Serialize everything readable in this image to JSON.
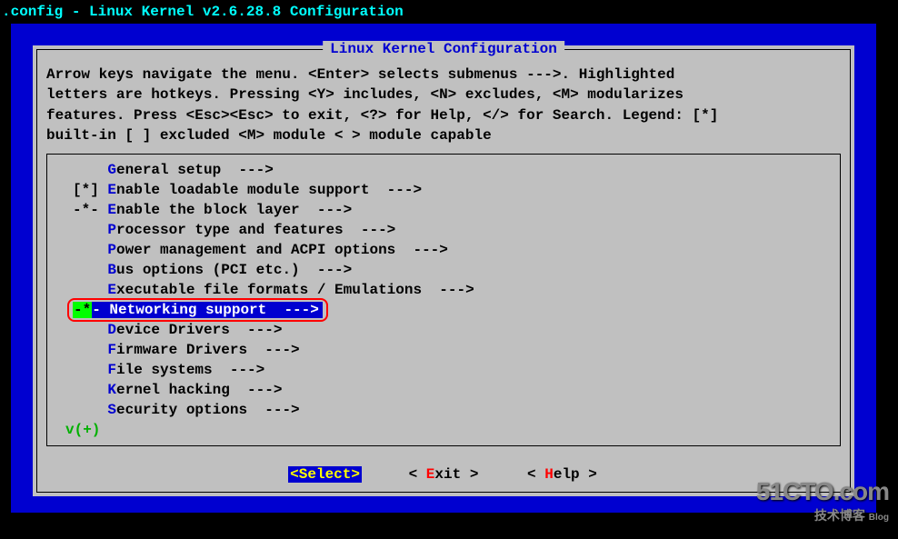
{
  "title_bar": ".config - Linux Kernel v2.6.28.8 Configuration",
  "box_title": "Linux Kernel Configuration",
  "help_lines": [
    "Arrow keys navigate the menu.  <Enter> selects submenus --->.  Highlighted",
    "letters are hotkeys.  Pressing <Y> includes, <N> excludes, <M> modularizes",
    "features.  Press <Esc><Esc> to exit, <?> for Help, </> for Search.  Legend: [*]",
    "built-in  [ ] excluded  <M> module  < > module capable"
  ],
  "menu": [
    {
      "prefix": "    ",
      "hot": "G",
      "rest": "eneral setup  --->",
      "selected": false
    },
    {
      "prefix": "[*] ",
      "hot": "E",
      "rest": "nable loadable module support  --->",
      "selected": false
    },
    {
      "prefix": "-*- ",
      "hot": "E",
      "rest": "nable the block layer  --->",
      "selected": false
    },
    {
      "prefix": "    ",
      "hot": "P",
      "rest": "rocessor type and features  --->",
      "selected": false
    },
    {
      "prefix": "    ",
      "hot": "P",
      "rest": "ower management and ACPI options  --->",
      "selected": false
    },
    {
      "prefix": "    ",
      "hot": "B",
      "rest": "us options (PCI etc.)  --->",
      "selected": false
    },
    {
      "prefix": "    ",
      "hot": "E",
      "rest": "xecutable file formats / Emulations  --->",
      "selected": false
    },
    {
      "prefix": "-*- ",
      "hot": "N",
      "rest": "etworking support  --->",
      "selected": true
    },
    {
      "prefix": "    ",
      "hot": "D",
      "rest": "evice Drivers  --->",
      "selected": false
    },
    {
      "prefix": "    ",
      "hot": "F",
      "rest": "irmware Drivers  --->",
      "selected": false
    },
    {
      "prefix": "    ",
      "hot": "F",
      "rest": "ile systems  --->",
      "selected": false
    },
    {
      "prefix": "    ",
      "hot": "K",
      "rest": "ernel hacking  --->",
      "selected": false
    },
    {
      "prefix": "    ",
      "hot": "S",
      "rest": "ecurity options  --->",
      "selected": false
    }
  ],
  "scroll_indicator": "v(+)",
  "buttons": {
    "select": {
      "open": "<",
      "hot": "S",
      "rest": "elect",
      "close": ">"
    },
    "exit": {
      "open": "< ",
      "hot": "E",
      "rest": "xit",
      "close": " >"
    },
    "help": {
      "open": "< ",
      "hot": "H",
      "rest": "elp",
      "close": " >"
    }
  },
  "watermark": {
    "big": "51CTO.com",
    "small": "技术博客",
    "tag": "Blog"
  }
}
